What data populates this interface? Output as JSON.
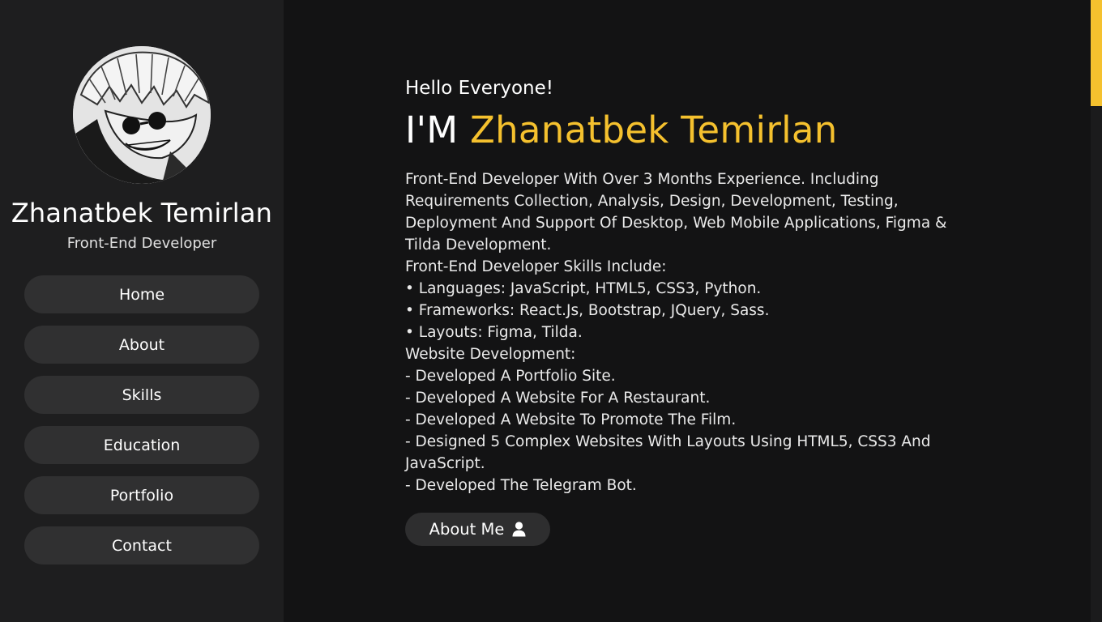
{
  "profile": {
    "name": "Zhanatbek Temirlan",
    "role": "Front-End Developer",
    "avatar_icon": "profile-photo"
  },
  "nav": {
    "items": [
      {
        "label": "Home"
      },
      {
        "label": "About"
      },
      {
        "label": "Skills"
      },
      {
        "label": "Education"
      },
      {
        "label": "Portfolio"
      },
      {
        "label": "Contact"
      }
    ]
  },
  "hero": {
    "greeting": "Hello Everyone!",
    "headline_prefix": "I'M",
    "headline_name": "Zhanatbek Temirlan",
    "bio_lines": [
      "Front-End Developer With Over 3 Months Experience. Including Requirements Collection, Analysis, Design, Development, Testing, Deployment And Support Of Desktop, Web Mobile Applications, Figma & Tilda Development.",
      "Front-End Developer Skills Include:",
      "• Languages: JavaScript, HTML5, CSS3, Python.",
      "• Frameworks: React.Js, Bootstrap, JQuery, Sass.",
      "• Layouts: Figma, Tilda.",
      "Website Development:",
      "- Developed A Portfolio Site.",
      "- Developed A Website For A Restaurant.",
      "- Developed A Website To Promote The Film.",
      "- Designed 5 Complex Websites With Layouts Using HTML5, CSS3 And JavaScript.",
      "- Developed The Telegram Bot."
    ],
    "button_label": "About Me",
    "button_icon": "user-icon"
  },
  "colors": {
    "accent": "#f5c12e",
    "background": "#131314",
    "sidebar": "#1e1e1f",
    "nav_button": "#303031"
  }
}
